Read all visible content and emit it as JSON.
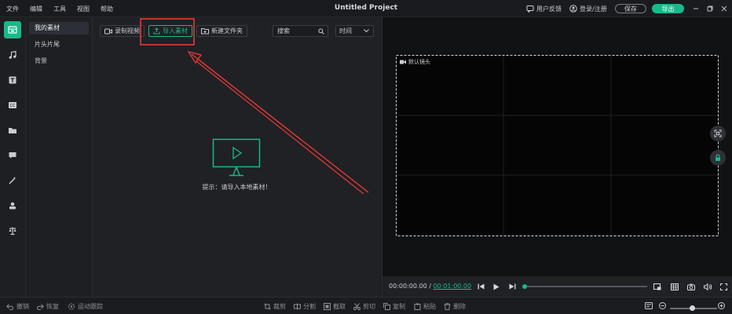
{
  "titlebar": {
    "menus": [
      "文件",
      "编辑",
      "工具",
      "视图",
      "帮助"
    ],
    "title": "Untitled Project",
    "feedback": "用户反馈",
    "login": "登录/注册",
    "save": "保存",
    "export": "导出"
  },
  "rail": {
    "icons": [
      "media-icon",
      "music-icon",
      "text-icon",
      "subtitle-icon",
      "folder-icon",
      "chat-icon",
      "magic-icon",
      "sticker-icon",
      "split-icon"
    ]
  },
  "categories": [
    "我的素材",
    "片头片尾",
    "背景"
  ],
  "media": {
    "record_label": "录制视频",
    "import_label": "导入素材",
    "new_folder_label": "新建文件夹",
    "search_placeholder": "搜索",
    "sort_value": "时间",
    "hint": "提示：请导入本地素材！"
  },
  "preview": {
    "camera_label": "默认镜头"
  },
  "player": {
    "current": "00:00:00.00",
    "separator": " / ",
    "total": "00:01:00.00",
    "progress": 0
  },
  "bottombar": {
    "undo": "撤销",
    "redo": "恢复",
    "motion": "运动跟踪",
    "crop": "裁剪",
    "split": "分割",
    "clip": "截取",
    "cut": "剪切",
    "copy": "复制",
    "paste": "粘贴",
    "delete": "删除",
    "zoom": 0.47
  },
  "colors": {
    "accent": "#19b88a",
    "annotation": "#e53935",
    "background": "#1f2125"
  }
}
